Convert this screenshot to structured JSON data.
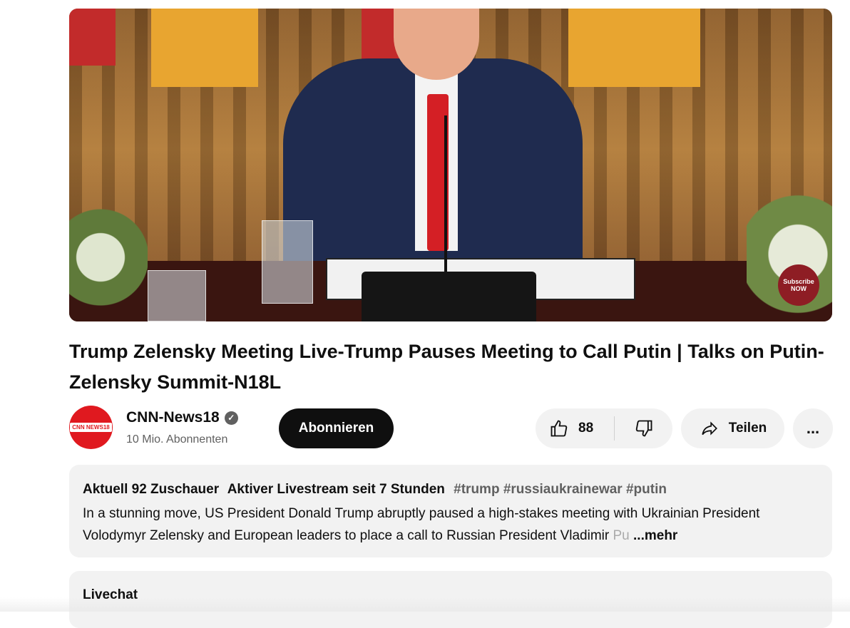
{
  "video": {
    "subscribe_badge": "Subscribe\nNOW"
  },
  "title": "Trump Zelensky Meeting Live-Trump Pauses Meeting to Call Putin | Talks on Putin-Zelensky Summit-N18L",
  "channel": {
    "avatar_text": "CNN NEWS18",
    "name": "CNN-News18",
    "verified_icon": "verified-check-icon",
    "subscribers": "10 Mio. Abonnenten",
    "subscribe_label": "Abonnieren"
  },
  "actions": {
    "like_count": "88",
    "like_icon": "thumbs-up-icon",
    "dislike_icon": "thumbs-down-icon",
    "share_label": "Teilen",
    "share_icon": "share-arrow-icon",
    "more_label": "..."
  },
  "description": {
    "viewers": "Aktuell 92 Zuschauer",
    "live_status": "Aktiver Livestream seit 7 Stunden",
    "hashtags": "#trump #russiaukrainewar #putin",
    "text_main": "In a stunning move, US President Donald Trump abruptly paused a high-stakes meeting with Ukrainian President Volodymyr Zelensky and European leaders to place a call to Russian President Vladimir ",
    "text_faded": "Pu",
    "more_label": " ...mehr"
  },
  "livechat": {
    "title": "Livechat"
  }
}
